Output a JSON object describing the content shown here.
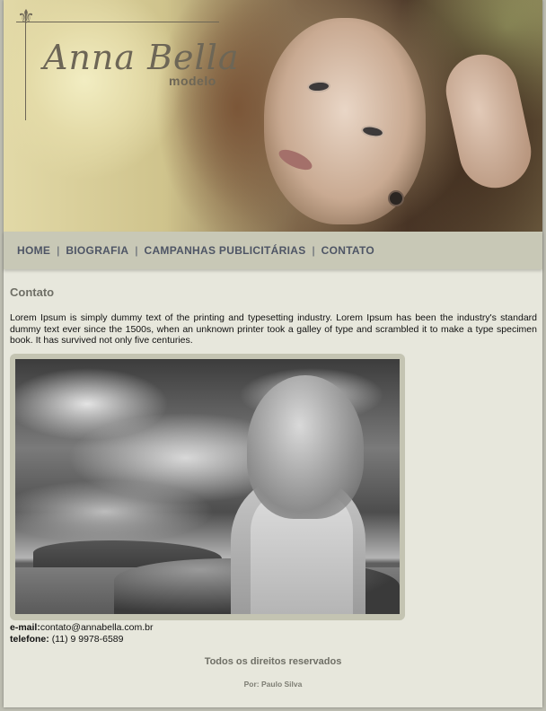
{
  "header": {
    "brand_name": "Anna Bella",
    "brand_subtitle": "modelo",
    "logo_icon": "fleur-de-lis-icon",
    "colors": {
      "brand_text": "#6d6656"
    }
  },
  "nav": {
    "items": [
      {
        "label": "HOME"
      },
      {
        "label": "BIOGRAFIA"
      },
      {
        "label": "CAMPANHAS PUBLICITÁRIAS"
      },
      {
        "label": "CONTATO"
      }
    ],
    "separator": "|",
    "colors": {
      "bar": "#c8c8b6",
      "link": "#4e5565"
    }
  },
  "main": {
    "title": "Contato",
    "intro": "Lorem Ipsum is simply dummy text of the printing and typesetting industry. Lorem Ipsum has been the industry's standard dummy text ever since the 1500s, when an unknown printer took a galley of type and scrambled it to make a type specimen book. It has survived not only five centuries.",
    "contact": {
      "email_label": "e-mail:",
      "email_value": "contato@annabella.com.br",
      "phone_label": "telefone:",
      "phone_value": "(11) 9 9978-6589"
    },
    "colors": {
      "background": "#e7e7dc",
      "frame": "#c4c4b2"
    }
  },
  "footer": {
    "rights": "Todos os direitos reservados",
    "credit": "Por: Paulo Silva"
  }
}
